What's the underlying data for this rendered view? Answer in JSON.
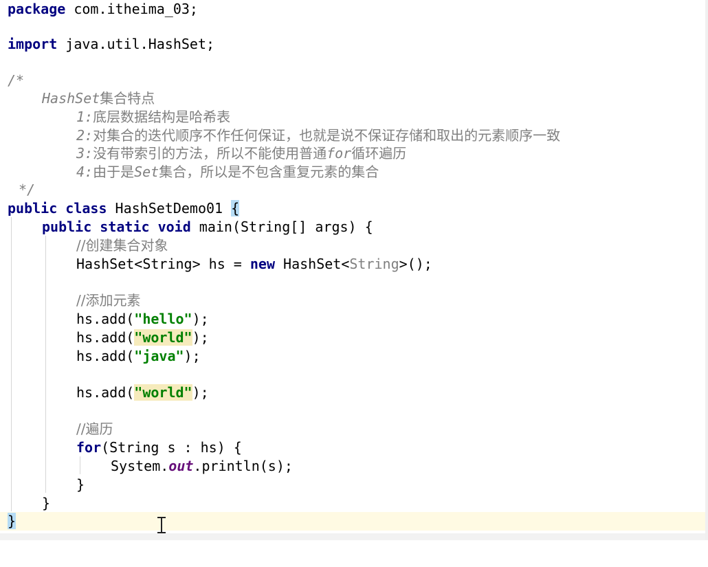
{
  "editor": {
    "package_kw": "package",
    "package_name": " com.itheima_03;",
    "import_kw": "import",
    "import_name": " java.util.HashSet;",
    "comment_open": "/*",
    "comment_title_a": "HashSet",
    "comment_title_b": "集合特点",
    "c1_num": "1:",
    "c1_text": "底层数据结构是哈希表",
    "c2_num": "2:",
    "c2_text": "对集合的迭代顺序不作任何保证，也就是说不保证存储和取出的元素顺序一致",
    "c3_num": "3:",
    "c3_text_a": "没有带索引的方法，所以不能使用普通",
    "c3_for": "for",
    "c3_text_b": "循环遍历",
    "c4_num": "4:",
    "c4_text_a": "由于是",
    "c4_set": "Set",
    "c4_text_b": "集合，所以是不包含重复元素的集合",
    "comment_close": "*/",
    "class_kw": "public class",
    "class_name": " HashSetDemo01 ",
    "class_brace": "{",
    "main_kw": "public static void",
    "main_sig": " main(String[] args) {",
    "comment_create": "//创建集合对象",
    "decl_type": "HashSet<String> hs = ",
    "decl_new": "new",
    "decl_ctor_a": " HashSet<",
    "decl_ctor_gen": "String",
    "decl_ctor_b": ">();",
    "comment_add": "//添加元素",
    "add_prefix": "hs.add(",
    "add_suffix": ");",
    "str_hello": "\"hello\"",
    "str_world": "\"world\"",
    "str_java": "\"java\"",
    "comment_iter": "//遍历",
    "for_kw": "for",
    "for_rest": "(String s : hs) {",
    "sys_a": "System.",
    "sys_out": "out",
    "sys_b": ".println(s);",
    "close_brace": "}"
  }
}
